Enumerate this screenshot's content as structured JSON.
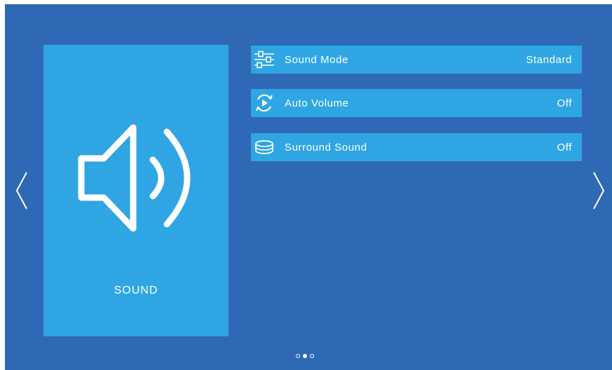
{
  "category": {
    "label": "SOUND",
    "icon": "speaker-icon"
  },
  "menu": [
    {
      "label": "Sound Mode",
      "value": "Standard",
      "icon": "equalizer-icon"
    },
    {
      "label": "Auto Volume",
      "value": "Off",
      "icon": "auto-volume-icon"
    },
    {
      "label": "Surround Sound",
      "value": "Off",
      "icon": "surround-sound-icon"
    }
  ],
  "navigation": {
    "prev_icon": "chevron-left-icon",
    "next_icon": "chevron-right-icon"
  },
  "pagination": {
    "total": 3,
    "active": 2
  },
  "colors": {
    "background": "#2f68b4",
    "card": "#2fa6e3",
    "text": "#ffffff"
  }
}
